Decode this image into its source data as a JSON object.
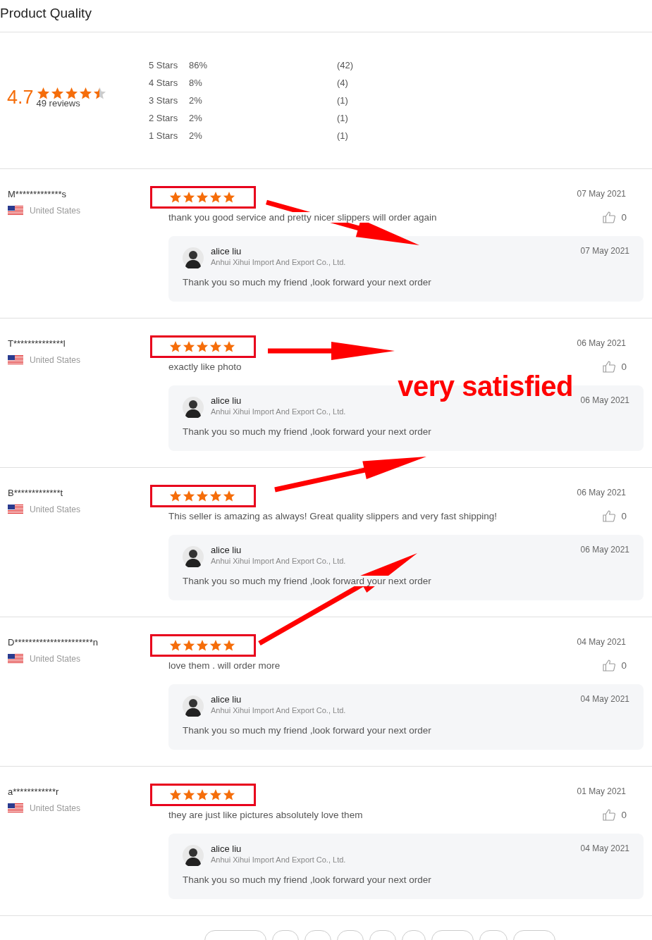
{
  "title": "Product Quality",
  "summary": {
    "rating": "4.7",
    "stars": 4.5,
    "count": "49 reviews",
    "breakdown": [
      {
        "label": "5 Stars",
        "percent": "86%",
        "count": "(42)"
      },
      {
        "label": "4 Stars",
        "percent": "8%",
        "count": "(4)"
      },
      {
        "label": "3 Stars",
        "percent": "2%",
        "count": "(1)"
      },
      {
        "label": "2 Stars",
        "percent": "2%",
        "count": "(1)"
      },
      {
        "label": "1 Stars",
        "percent": "2%",
        "count": "(1)"
      }
    ]
  },
  "reviews": [
    {
      "name": "M*************s",
      "country": "United States",
      "stars": 5,
      "highlighted": true,
      "date": "07 May 2021",
      "text": "thank you good service and pretty nicer slippers will order again",
      "likes": "0",
      "reply": {
        "name": "alice liu",
        "company": "Anhui Xihui Import And Export Co., Ltd.",
        "date": "07 May 2021",
        "text": "Thank you so much my friend ,look forward your next order"
      }
    },
    {
      "name": "T**************l",
      "country": "United States",
      "stars": 5,
      "highlighted": true,
      "date": "06 May 2021",
      "text": "exactly like photo",
      "likes": "0",
      "reply": {
        "name": "alice liu",
        "company": "Anhui Xihui Import And Export Co., Ltd.",
        "date": "06 May 2021",
        "text": "Thank you so much my friend ,look forward your next order"
      }
    },
    {
      "name": "B*************t",
      "country": "United States",
      "stars": 5,
      "highlighted": true,
      "date": "06 May 2021",
      "text": "This seller is amazing as always! Great quality slippers and very fast shipping!",
      "likes": "0",
      "reply": {
        "name": "alice liu",
        "company": "Anhui Xihui Import And Export Co., Ltd.",
        "date": "06 May 2021",
        "text": "Thank you so much my friend ,look forward your next order"
      }
    },
    {
      "name": "D**********************n",
      "country": "United States",
      "stars": 5,
      "highlighted": true,
      "date": "04 May 2021",
      "text": "love them . will order more",
      "likes": "0",
      "reply": {
        "name": "alice liu",
        "company": "Anhui Xihui Import And Export Co., Ltd.",
        "date": "04 May 2021",
        "text": "Thank you so much my friend ,look forward your next order"
      }
    },
    {
      "name": "a************r",
      "country": "United States",
      "stars": 5,
      "highlighted": true,
      "date": "01 May 2021",
      "text": "they are just like pictures absolutely love them",
      "likes": "0",
      "reply": {
        "name": "alice liu",
        "company": "Anhui Xihui Import And Export Co., Ltd.",
        "date": "04 May 2021",
        "text": "Thank you so much my friend ,look forward your next order"
      }
    }
  ],
  "annotation": {
    "caption": "very satisfied"
  }
}
